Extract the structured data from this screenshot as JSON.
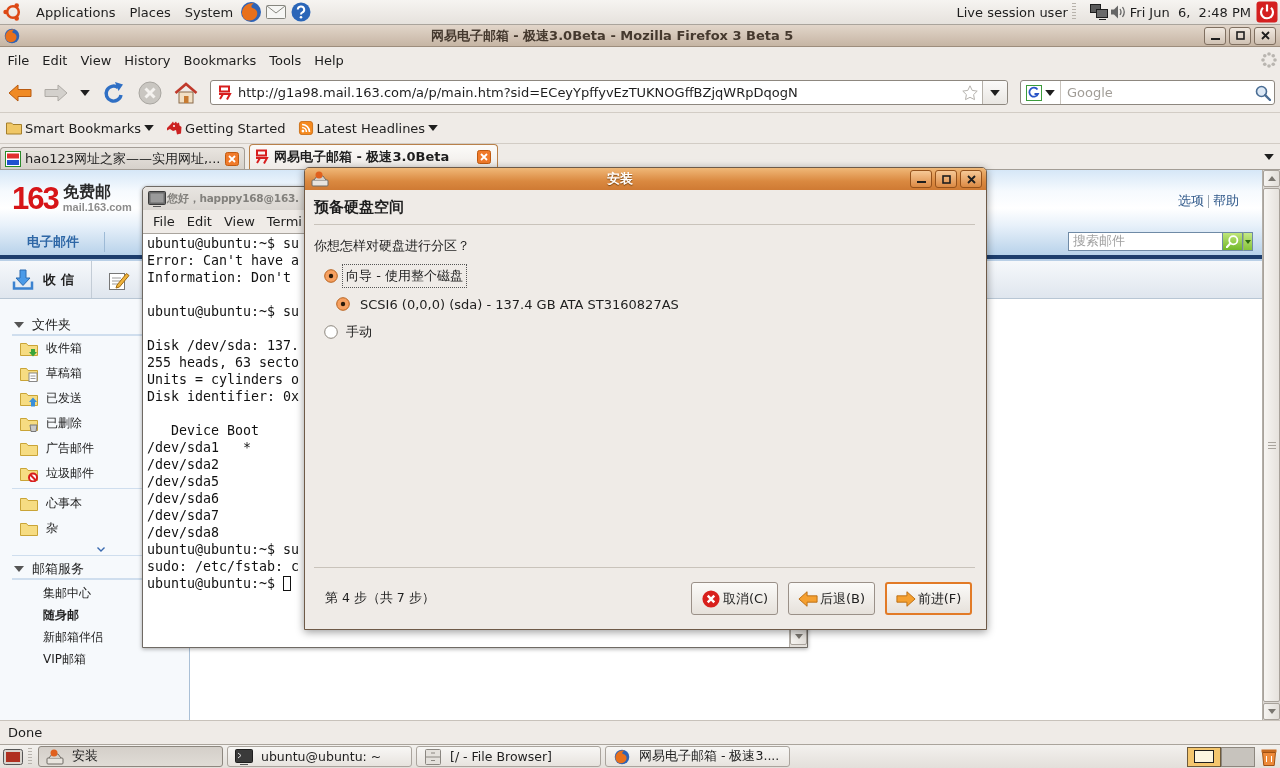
{
  "top_panel": {
    "menus": [
      "Applications",
      "Places",
      "System"
    ],
    "user": "Live session user",
    "clock": "Fri Jun  6,  2:48 PM"
  },
  "firefox": {
    "title": "网易电子邮箱 - 极速3.0Beta - Mozilla Firefox 3 Beta 5",
    "menu": [
      "File",
      "Edit",
      "View",
      "History",
      "Bookmarks",
      "Tools",
      "Help"
    ],
    "url": "http://g1a98.mail.163.com/a/p/main.htm?sid=ECeyYpffyvEzTUKNOGffBZjqWRpDqogN",
    "search": {
      "placeholder": "Google"
    },
    "bookmarks": [
      {
        "label": "Smart Bookmarks",
        "kind": "folder"
      },
      {
        "label": "Getting Started",
        "kind": "page"
      },
      {
        "label": "Latest Headlines",
        "kind": "feed"
      }
    ],
    "tabs": [
      {
        "label": "hao123网址之家——实用网址,...",
        "kind": "hao123",
        "selected": false
      },
      {
        "label": "网易电子邮箱 - 极速3.0Beta",
        "kind": "netease",
        "selected": true
      }
    ],
    "status": "Done"
  },
  "mail_page": {
    "logo": {
      "number": "163",
      "name": "免费邮",
      "domain": "mail.163.com"
    },
    "links": [
      "选项",
      "帮助"
    ],
    "nav_tab": "电子邮件",
    "search": {
      "placeholder": "搜索邮件"
    },
    "receive_button": "收 信",
    "folders": {
      "title": "文件夹",
      "expanded": true,
      "groups": [
        [
          {
            "label": "收件箱",
            "kind": "inbox"
          },
          {
            "label": "草稿箱",
            "kind": "drafts"
          },
          {
            "label": "已发送",
            "kind": "sent"
          },
          {
            "label": "已删除",
            "kind": "trash"
          },
          {
            "label": "广告邮件",
            "kind": "plain"
          },
          {
            "label": "垃圾邮件",
            "kind": "spam"
          }
        ],
        [
          {
            "label": "心事本",
            "kind": "plain"
          },
          {
            "label": "杂",
            "kind": "plain"
          }
        ]
      ]
    },
    "services": {
      "title": "邮箱服务",
      "expanded": true,
      "items": [
        {
          "label": "集邮中心",
          "emphasized": false
        },
        {
          "label": "随身邮",
          "emphasized": true
        },
        {
          "label": "新邮箱伴侣",
          "emphasized": false
        },
        {
          "label": "VIP邮箱",
          "emphasized": false
        }
      ]
    }
  },
  "terminal": {
    "title": "您好，happpy168@163.",
    "menu": [
      "File",
      "Edit",
      "View",
      "Termi"
    ],
    "blocks": [
      [
        "ubuntu@ubuntu:~$ su",
        "Error: Can't have a",
        "Information: Don't"
      ],
      [
        "ubuntu@ubuntu:~$ su"
      ],
      [
        "Disk /dev/sda: 137.",
        "255 heads, 63 secto",
        "Units = cylinders o",
        "Disk identifier: 0x"
      ],
      [
        "   Device Boot",
        "/dev/sda1   *",
        "/dev/sda2",
        "/dev/sda5",
        "/dev/sda6",
        "/dev/sda7",
        "/dev/sda8",
        "ubuntu@ubuntu:~$ su",
        "sudo: /etc/fstab: c",
        "ubuntu@ubuntu:~$ "
      ]
    ],
    "cursor": true
  },
  "dialog": {
    "title": "安装",
    "heading": "预备硬盘空间",
    "question": "你想怎样对硬盘进行分区？",
    "options": [
      {
        "label": "向导 - 使用整个磁盘",
        "selected": true,
        "focused": true,
        "children": [
          {
            "label": "SCSI6 (0,0,0) (sda) - 137.4 GB ATA ST3160827AS",
            "selected": true,
            "focused": false
          }
        ]
      },
      {
        "label": "手动",
        "selected": false,
        "focused": false
      }
    ],
    "step": "第 4 步（共 7 步）",
    "buttons": [
      {
        "label": "取消(C)",
        "kind": "cancel",
        "default": false
      },
      {
        "label": "后退(B)",
        "kind": "back",
        "default": false
      },
      {
        "label": "前进(F)",
        "kind": "forward",
        "default": true
      }
    ]
  },
  "bottom_panel": {
    "tasks": [
      {
        "label": "安装",
        "kind": "installer",
        "selected": true
      },
      {
        "label": "ubuntu@ubuntu: ~",
        "kind": "terminal",
        "selected": false
      },
      {
        "label": "[/ - File Browser]",
        "kind": "files",
        "selected": false
      },
      {
        "label": "网易电子邮箱 - 极速3....",
        "kind": "browser",
        "selected": false
      }
    ],
    "workspaces": [
      {
        "selected": true
      },
      {
        "selected": false
      }
    ]
  }
}
